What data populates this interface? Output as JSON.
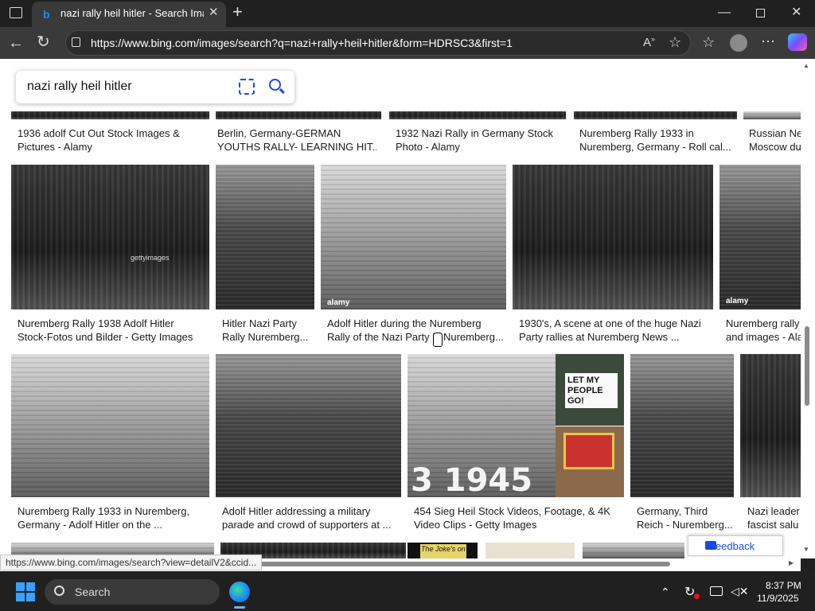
{
  "browser": {
    "tab_title": "nazi rally heil hitler - Search Images",
    "url": "https://www.bing.com/images/search?q=nazi+rally+heil+hitler&form=HDRSC3&first=1",
    "new_tab_icon": "+"
  },
  "search": {
    "query": "nazi rally heil hitler"
  },
  "rows": {
    "row0": [
      {
        "caption1": "1936 adolf Cut Out Stock Images &",
        "caption2": "Pictures - Alamy"
      },
      {
        "caption1": "Berlin, Germany-GERMAN",
        "caption2": "YOUTHS RALLY- LEARNING HIT..."
      },
      {
        "caption1": "1932 Nazi Rally in Germany Stock",
        "caption2": "Photo - Alamy"
      },
      {
        "caption1": "Nuremberg Rally 1933 in",
        "caption2": "Nuremberg, Germany - Roll cal..."
      },
      {
        "caption1": "Russian Ne",
        "caption2": "Moscow du"
      }
    ],
    "row1": [
      {
        "caption1": "Nuremberg Rally 1938 Adolf Hitler",
        "caption2": "Stock-Fotos und Bilder - Getty Images"
      },
      {
        "caption1": "Hitler Nazi Party",
        "caption2": "Rally Nuremberg..."
      },
      {
        "caption1": "Adolf Hitler during the Nuremberg",
        "caption2": "Rally of the Nazi Party in Nuremberg..."
      },
      {
        "caption1": "1930's, A scene at one of the huge Nazi",
        "caption2": "Party rallies at Nuremberg News ..."
      },
      {
        "caption1": "Nuremberg rally",
        "caption2": "and images - Ala"
      }
    ],
    "row2": [
      {
        "caption1": "Nuremberg Rally 1933 in Nuremberg,",
        "caption2": "Germany - Adolf Hitler on the ..."
      },
      {
        "caption1": "Adolf Hitler addressing a military",
        "caption2": "parade and crowd of supporters at ..."
      },
      {
        "caption1": "454 Sieg Heil Stock Videos, Footage, & 4K",
        "caption2": "Video Clips - Getty Images"
      },
      {
        "caption1": "Germany, Third",
        "caption2": "Reich - Nuremberg..."
      },
      {
        "caption1": "Nazi leader",
        "caption2": "fascist salu"
      }
    ]
  },
  "thumb_text": {
    "getty1": "gettyimages",
    "alamy1": "alamy",
    "alamy2": "alamy",
    "alamy3": "alamy",
    "sign1": "LET MY PEOPLE GO!",
    "year_overlay": "3 1945",
    "book_title": "The Joke's on"
  },
  "feedback_label": "Feedback",
  "status_url": "https://www.bing.com/images/search?view=detailV2&ccid...",
  "taskbar": {
    "search_label": "Search",
    "time": "8:37 PM",
    "date": "11/9/2025"
  },
  "colors": {
    "accent": "#174ae4",
    "tab_bg": "#3a3a3a",
    "chrome_bg": "#202020"
  }
}
